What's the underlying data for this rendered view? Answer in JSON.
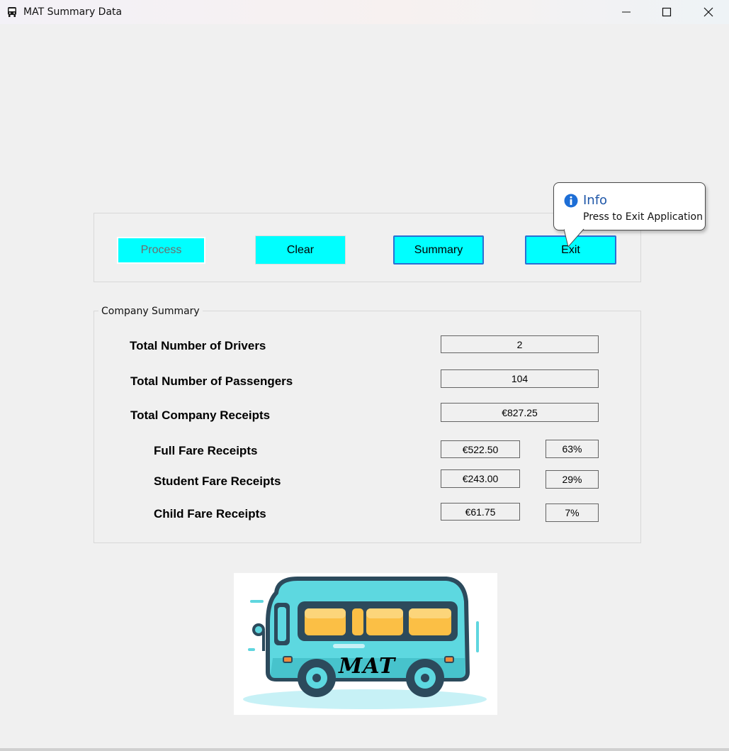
{
  "window": {
    "title": "MAT Summary Data",
    "app_icon": "bus-icon",
    "controls": [
      "minimize-icon",
      "maximize-icon",
      "close-icon"
    ]
  },
  "buttons": {
    "process": "Process",
    "clear": "Clear",
    "summary": "Summary",
    "exit": "Exit"
  },
  "tooltip": {
    "title": "Info",
    "text": "Press to Exit Application",
    "icon": "info-icon"
  },
  "summary": {
    "group_title": "Company Summary",
    "rows": [
      {
        "label": "Total Number of Drivers",
        "value": "2"
      },
      {
        "label": "Total Number of Passengers",
        "value": "104"
      },
      {
        "label": "Total Company Receipts",
        "value": "€827.25"
      }
    ],
    "fares": [
      {
        "label": "Full Fare Receipts",
        "value": "€522.50",
        "percent": "63%"
      },
      {
        "label": "Student Fare Receipts",
        "value": "€243.00",
        "percent": "29%"
      },
      {
        "label": "Child Fare Receipts",
        "value": "€61.75",
        "percent": "7%"
      }
    ]
  },
  "logo": {
    "text": "MAT",
    "icon": "bus-illustration"
  },
  "colors": {
    "button_bg": "#00ffff",
    "focus_border": "#2a6fd4",
    "window_bg": "#f0f0f0"
  }
}
